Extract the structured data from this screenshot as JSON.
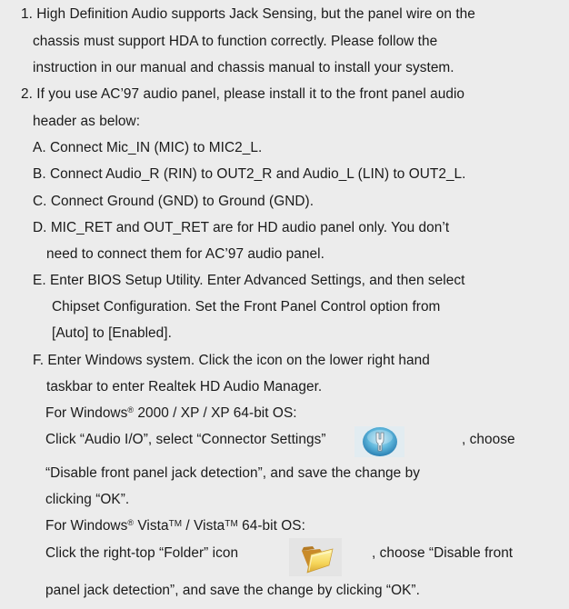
{
  "notes": {
    "item1": {
      "line1": "1. High Definition Audio supports Jack Sensing, but the panel wire on the",
      "line2": "chassis must support HDA to function correctly. Please follow the",
      "line3": "instruction in our manual and chassis manual to install your system."
    },
    "item2": {
      "line1": "2. If you use AC’97 audio panel, please install it to the front panel audio",
      "line2": "header as below:"
    },
    "stepA": "A. Connect Mic_IN (MIC) to MIC2_L.",
    "stepB": "B. Connect Audio_R (RIN) to OUT2_R and Audio_L (LIN) to OUT2_L.",
    "stepC": "C. Connect Ground (GND) to Ground (GND).",
    "stepD": {
      "line1": "D. MIC_RET and OUT_RET are for HD audio panel only. You don’t",
      "line2": "need to connect them for AC’97 audio panel."
    },
    "stepE": {
      "line1": "E. Enter BIOS Setup Utility. Enter Advanced Settings, and then select",
      "line2": "Chipset Configuration. Set the Front Panel Control option from",
      "line3": "[Auto] to [Enabled]."
    },
    "stepF": {
      "line1": "F. Enter Windows system. Click the icon on the lower right hand",
      "line2": "taskbar to enter Realtek HD Audio Manager.",
      "win2000": {
        "pre": "For Windows",
        "reg": "®",
        "post": " 2000 / XP / XP 64-bit OS:",
        "click_a": "Click “Audio I/O”, select “Connector Settings”",
        "choose": ", choose",
        "line_b": "“Disable front panel jack detection”, and save the change by",
        "line_c": "clicking “OK”."
      },
      "vista": {
        "pre": "For Windows",
        "reg": "®",
        "mid1": " Vista",
        "tm1": "TM",
        "mid2": " / Vista",
        "tm2": "TM",
        "post": " 64-bit OS:",
        "click_a": "Click the right-top “Folder” icon",
        "choose": ", choose “Disable front",
        "line_b": "panel jack detection”, and save the change by clicking “OK”."
      }
    }
  },
  "icons": {
    "connector_settings": "connector-settings-icon",
    "folder": "folder-icon"
  }
}
